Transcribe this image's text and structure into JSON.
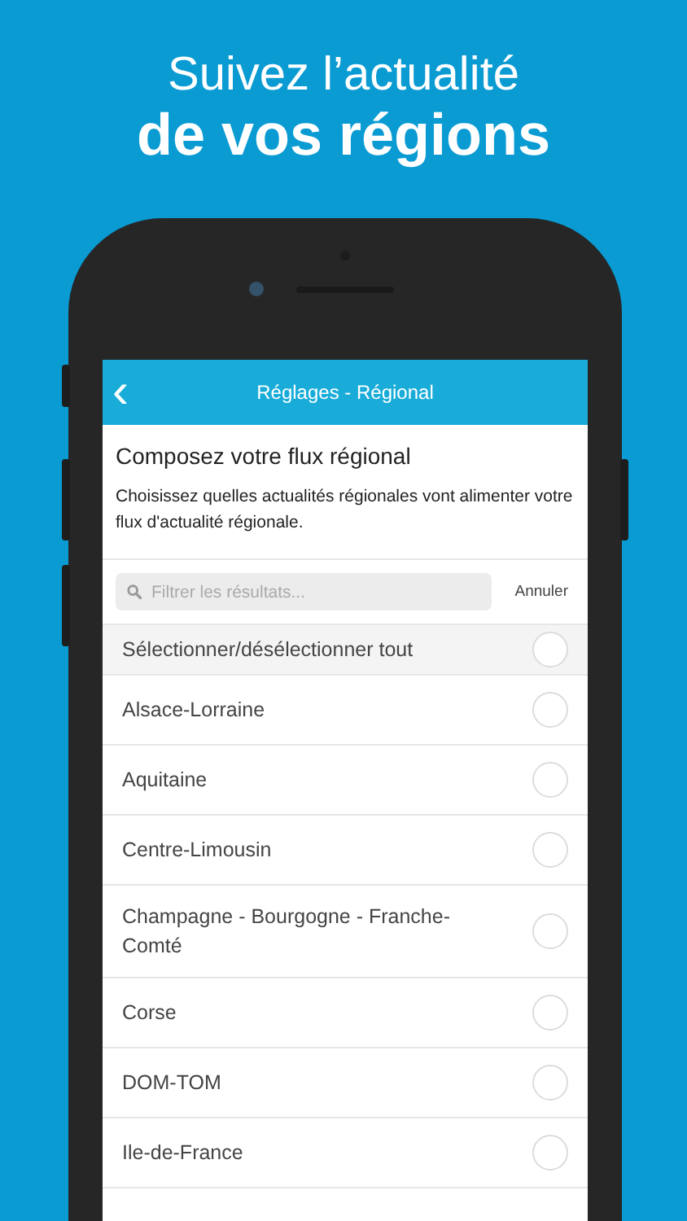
{
  "headline": {
    "line_1": "Suivez l’actualité",
    "line_2": "de vos régions"
  },
  "app_bar": {
    "back_icon": "‹",
    "title": "Réglages - Régional"
  },
  "intro": {
    "heading": "Composez votre flux régional",
    "description": "Choisissez quelles actualités régionales vont alimenter votre flux d'actualité régionale."
  },
  "search": {
    "placeholder": "Filtrer les résultats...",
    "cancel": "Annuler"
  },
  "select_all": {
    "label": "Sélectionner/désélectionner tout",
    "selected": false
  },
  "regions": [
    {
      "label": "Alsace-Lorraine",
      "selected": false
    },
    {
      "label": "Aquitaine",
      "selected": false
    },
    {
      "label": "Centre-Limousin",
      "selected": false
    },
    {
      "label": "Champagne - Bourgogne - Franche-Comté",
      "selected": false
    },
    {
      "label": "Corse",
      "selected": false
    },
    {
      "label": "DOM-TOM",
      "selected": false
    },
    {
      "label": "Ile-de-France",
      "selected": false
    }
  ]
}
